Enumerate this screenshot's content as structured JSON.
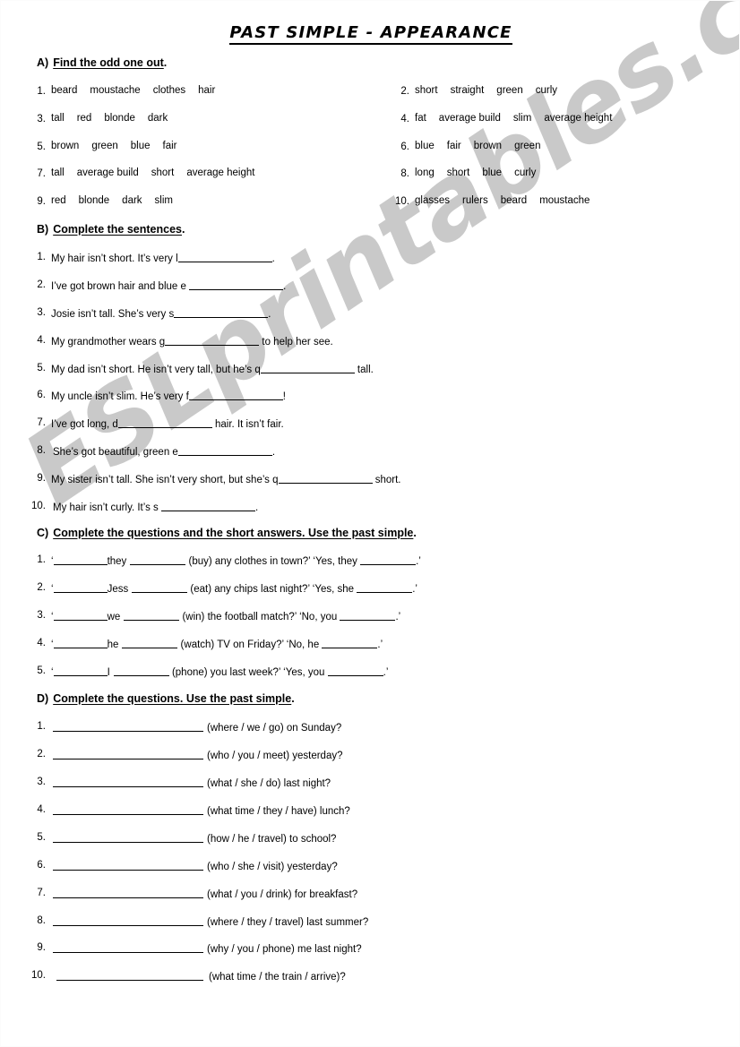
{
  "worksheet": {
    "title": "PAST SIMPLE - APPEARANCE",
    "watermark": "ESLprintables.com"
  },
  "sections": {
    "a": {
      "label": "A)",
      "heading": "Find the odd one out",
      "heading_period": ".",
      "items_left": [
        {
          "n": "1.",
          "words": [
            "beard",
            "moustache",
            "clothes",
            "hair"
          ]
        },
        {
          "n": "3.",
          "words": [
            "tall",
            "red",
            "blonde",
            "dark"
          ]
        },
        {
          "n": "5.",
          "words": [
            "brown",
            "green",
            "blue",
            "fair"
          ]
        },
        {
          "n": "7.",
          "words": [
            "tall",
            "average build",
            "short",
            "average height"
          ]
        },
        {
          "n": "9.",
          "words": [
            "red",
            "blonde",
            "dark",
            "slim"
          ]
        }
      ],
      "items_right": [
        {
          "n": "2.",
          "words": [
            "short",
            "straight",
            "green",
            "curly"
          ]
        },
        {
          "n": "4.",
          "words": [
            "fat",
            "average build",
            "slim",
            "average height"
          ]
        },
        {
          "n": "6.",
          "words": [
            "blue",
            "fair",
            "brown",
            "green"
          ]
        },
        {
          "n": "8.",
          "words": [
            "long",
            "short",
            "blue",
            "curly"
          ]
        },
        {
          "n": "10.",
          "words": [
            "glasses",
            "rulers",
            "beard",
            "moustache"
          ]
        }
      ]
    },
    "b": {
      "label": "B)",
      "heading": "Complete the sentences",
      "heading_period": ".",
      "items": [
        {
          "n": "1.",
          "pre": "My hair isn’t short. It’s very l",
          "post": "."
        },
        {
          "n": "2.",
          "pre": "I’ve got brown hair and blue e ",
          "post": "."
        },
        {
          "n": "3.",
          "pre": "Josie isn’t tall. She’s very s",
          "post": "."
        },
        {
          "n": "4.",
          "pre": "My grandmother wears g",
          "post": " to help her see."
        },
        {
          "n": "5.",
          "pre": "My dad isn’t short. He isn’t very tall, but he’s q",
          "post": " tall."
        },
        {
          "n": "6.",
          "pre": "My uncle isn’t slim. He’s very f",
          "post": "!"
        },
        {
          "n": "7.",
          "pre": "I’ve got long, d",
          "post": " hair. It isn’t fair."
        },
        {
          "n": "8.",
          "pre": "She’s got beautiful, green e",
          "post": "."
        },
        {
          "n": "9.",
          "pre": "My sister isn’t tall. She isn’t very short, but she’s q",
          "post": " short."
        },
        {
          "n": "10.",
          "pre": "My hair isn’t curly. It’s s ",
          "post": "."
        }
      ]
    },
    "c": {
      "label": "C)",
      "heading": "Complete the questions and the short answers. Use the past simple",
      "heading_period": ".",
      "items": [
        {
          "n": "1.",
          "q_open": "‘",
          "mid1": "they",
          "mid2": " (buy) any clothes in town?’ ‘Yes, they ",
          "q_close": ".’"
        },
        {
          "n": "2.",
          "q_open": "‘",
          "mid1": "Jess",
          "mid2": " (eat) any chips last night?’ ‘Yes, she ",
          "q_close": ".’"
        },
        {
          "n": "3.",
          "q_open": "‘",
          "mid1": "we",
          "mid2": " (win) the football match?’ ‘No, you ",
          "q_close": ".’"
        },
        {
          "n": "4.",
          "q_open": "‘",
          "mid1": "he",
          "mid2": " (watch) TV on Friday?’ ‘No, he ",
          "q_close": ".’"
        },
        {
          "n": "5.",
          "q_open": "‘",
          "mid1": "I",
          "mid2": " (phone) you last week?’ ‘Yes, you ",
          "q_close": ".’"
        }
      ]
    },
    "d": {
      "label": "D)",
      "heading": "Complete the questions. Use the past simple",
      "heading_period": ".",
      "items": [
        {
          "n": "1.",
          "prompt": "(where / we / go) on Sunday?"
        },
        {
          "n": "2.",
          "prompt": "(who / you / meet) yesterday?"
        },
        {
          "n": "3.",
          "prompt": "(what / she / do) last night?"
        },
        {
          "n": "4.",
          "prompt": "(what time / they / have) lunch?"
        },
        {
          "n": "5.",
          "prompt": "(how / he / travel) to school?"
        },
        {
          "n": "6.",
          "prompt": "(who / she / visit) yesterday?"
        },
        {
          "n": "7.",
          "prompt": "(what / you / drink) for breakfast?"
        },
        {
          "n": "8.",
          "prompt": "(where / they / travel) last summer?"
        },
        {
          "n": "9.",
          "prompt": "(why / you / phone) me last night?"
        },
        {
          "n": "10.",
          "prompt": "(what time / the train / arrive)?"
        }
      ]
    }
  }
}
